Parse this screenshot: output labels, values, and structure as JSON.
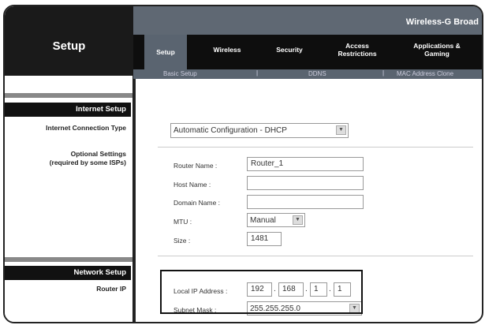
{
  "window": {
    "brand": "Wireless-G Broad"
  },
  "sidebar": {
    "title": "Setup",
    "internet_setup": "Internet Setup",
    "connection_type_label": "Internet Connection Type",
    "optional_label_1": "Optional Settings",
    "optional_label_2": "(required by some ISPs)",
    "network_setup": "Network Setup",
    "router_ip_label": "Router IP"
  },
  "tabs": [
    {
      "label": "Setup"
    },
    {
      "label": "Wireless"
    },
    {
      "label": "Security"
    },
    {
      "label": "Access Restrictions"
    },
    {
      "label": "Applications & Gaming"
    }
  ],
  "subtabs": [
    "Basic Setup",
    "DDNS",
    "MAC Address Clone"
  ],
  "internet": {
    "connection_type": "Automatic Configuration - DHCP"
  },
  "optional": {
    "router_name_label": "Router Name :",
    "router_name_value": "Router_1",
    "host_name_label": "Host Name :",
    "host_name_value": "",
    "domain_name_label": "Domain Name :",
    "domain_name_value": "",
    "mtu_label": "MTU :",
    "mtu_value": "Manual",
    "size_label": "Size :",
    "size_value": "1481"
  },
  "network": {
    "local_ip_label": "Local IP Address :",
    "ip": [
      "192",
      "168",
      "1",
      "1"
    ],
    "subnet_label": "Subnet Mask :",
    "subnet_value": "255.255.255.0"
  }
}
